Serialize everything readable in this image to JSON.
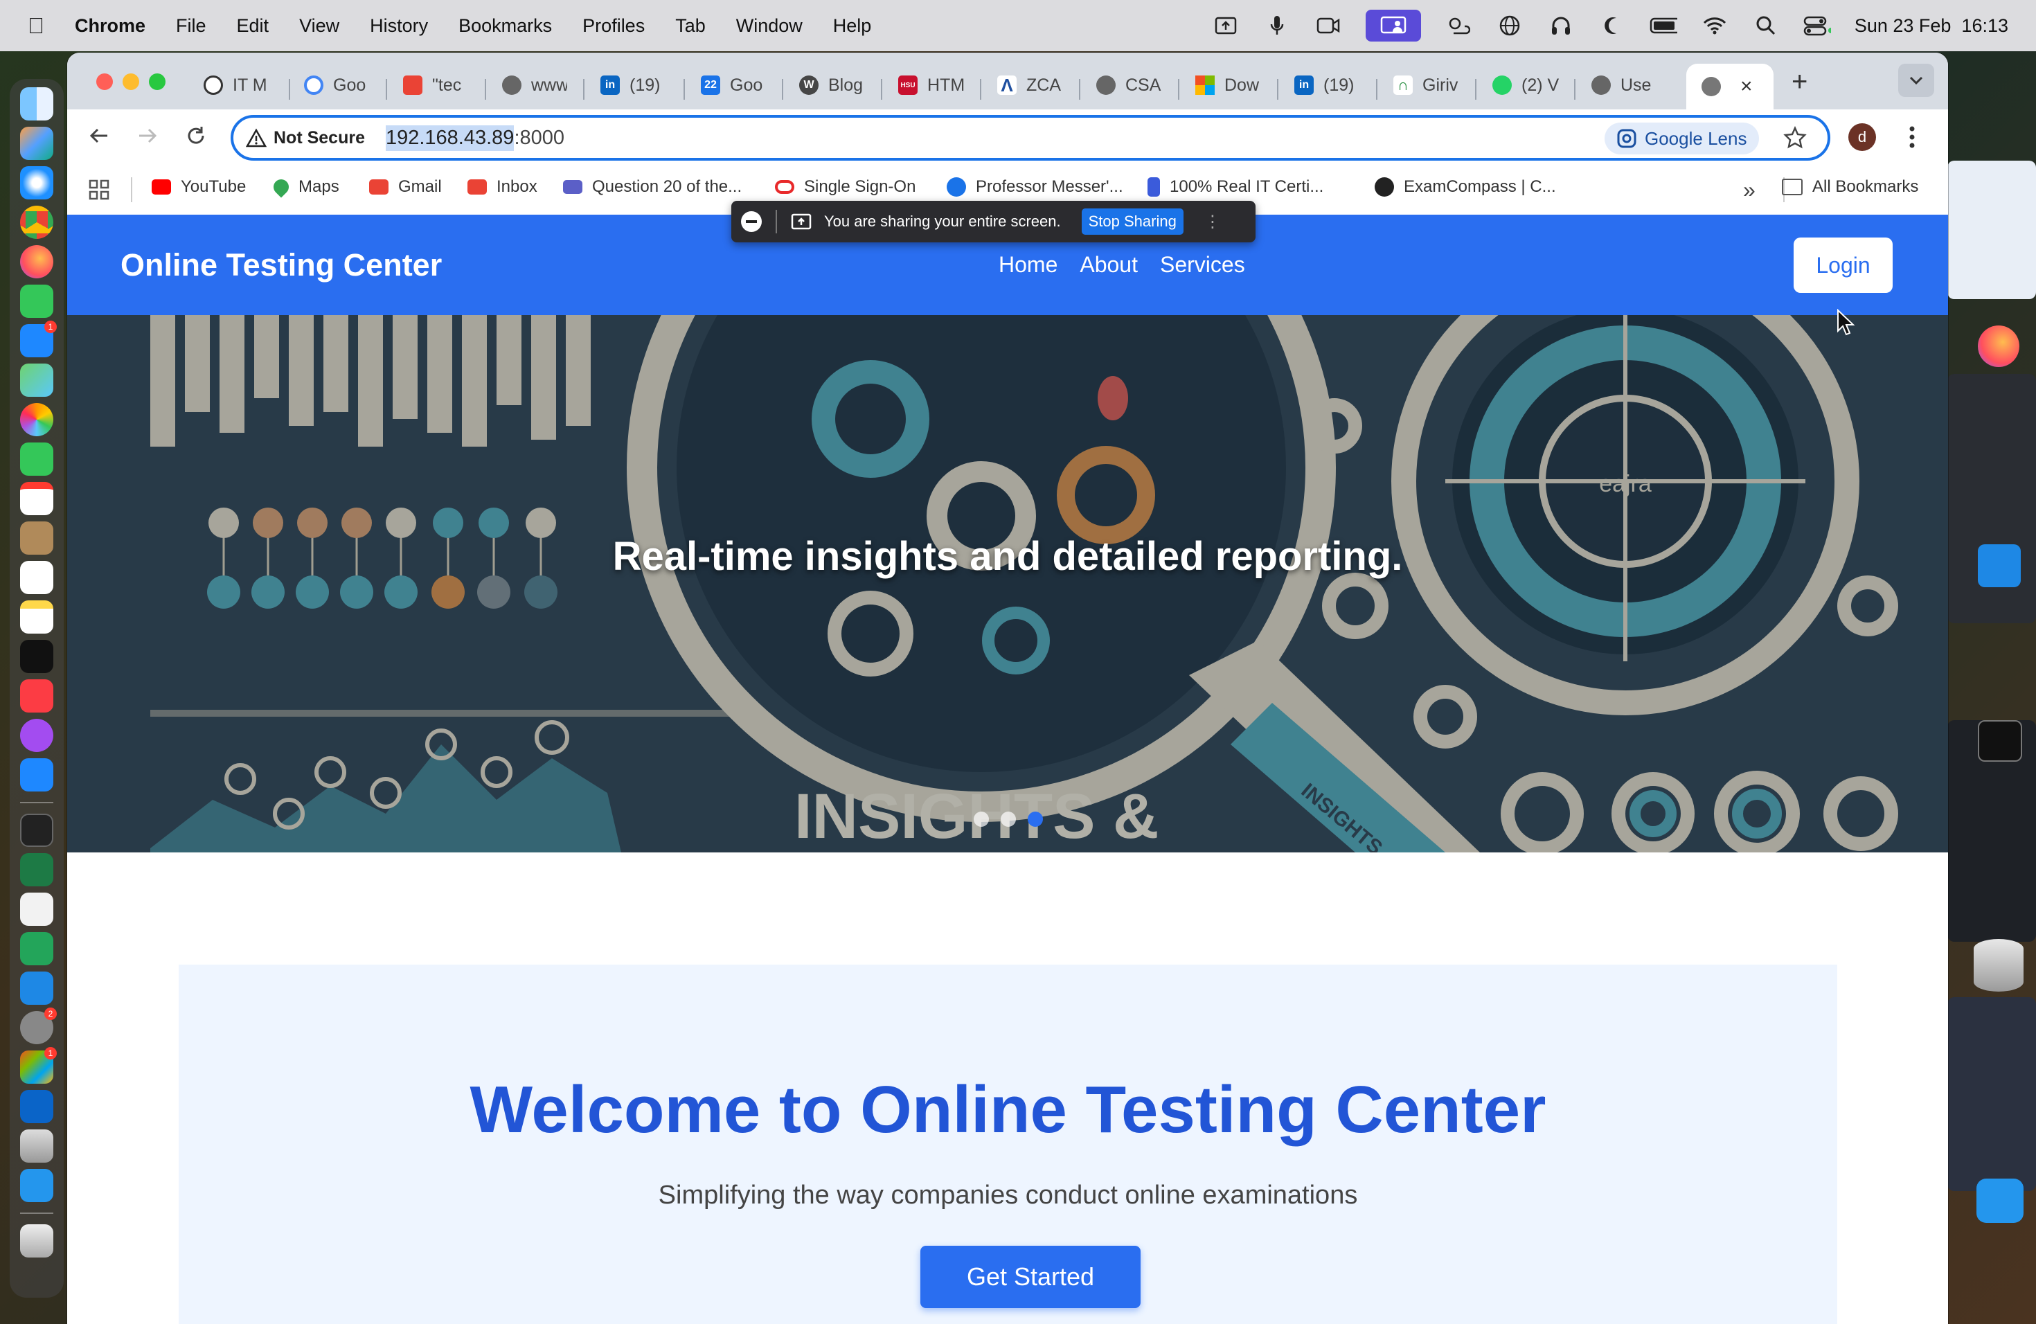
{
  "menubar": {
    "app": "Chrome",
    "items": [
      "File",
      "Edit",
      "View",
      "History",
      "Bookmarks",
      "Profiles",
      "Tab",
      "Window",
      "Help"
    ],
    "clock": "Sun 23 Feb  16:13"
  },
  "tabs": [
    {
      "label": "IT M",
      "icon": "openai-icon"
    },
    {
      "label": "Goo",
      "icon": "google-icon"
    },
    {
      "label": "\"tec",
      "icon": "gmail-icon"
    },
    {
      "label": "www",
      "icon": "globe-icon"
    },
    {
      "label": "(19)",
      "icon": "linkedin-icon"
    },
    {
      "label": "Goo",
      "icon": "google-calendar-icon"
    },
    {
      "label": "Blog",
      "icon": "wordpress-icon"
    },
    {
      "label": "HTM",
      "icon": "hsu-icon"
    },
    {
      "label": "ZCA",
      "icon": "zca-icon"
    },
    {
      "label": "CSA",
      "icon": "globe-icon"
    },
    {
      "label": "Dow",
      "icon": "microsoft-icon"
    },
    {
      "label": "(19)",
      "icon": "linkedin-icon"
    },
    {
      "label": "Giriv",
      "icon": "giri-icon"
    },
    {
      "label": "(2) V",
      "icon": "whatsapp-icon"
    },
    {
      "label": "Use",
      "icon": "globe-icon"
    }
  ],
  "address": {
    "security": "Not Secure",
    "host": "192.168.43.89",
    "port": ":8000",
    "lens": "Google Lens",
    "profile": "d"
  },
  "bookmarks": [
    {
      "label": "YouTube",
      "color": "#ff0000"
    },
    {
      "label": "Maps",
      "color": "#34a853"
    },
    {
      "label": "Gmail",
      "color": "#ea4335"
    },
    {
      "label": "Inbox",
      "color": "#ea4335"
    },
    {
      "label": "Question 20 of the...",
      "color": "#5b5fc7"
    },
    {
      "label": "Single Sign-On",
      "color": "#e8292a"
    },
    {
      "label": "Professor Messer'...",
      "color": "#1a73e8"
    },
    {
      "label": "100% Real IT Certi...",
      "color": "#3b5bdb"
    },
    {
      "label": "ExamCompass | C...",
      "color": "#222222"
    }
  ],
  "all_bookmarks": "All Bookmarks",
  "sharing": {
    "text": "You are sharing your entire screen.",
    "stop": "Stop Sharing"
  },
  "site": {
    "brand": "Online Testing Center",
    "nav": [
      "Home",
      "About",
      "Services"
    ],
    "login": "Login",
    "hero_text": "Real-time insights and detailed reporting.",
    "hero_caption": "INSIGHTS &",
    "hero_book": "INSIGHTS",
    "hero_dial": "eajra",
    "carousel": {
      "slides": 3,
      "active": 3
    },
    "welcome_title": "Welcome to Online Testing Center",
    "welcome_sub": "Simplifying the way companies conduct online examinations",
    "cta": "Get Started"
  },
  "colors": {
    "primary": "#2a6ef0",
    "title_blue": "#2255d6",
    "welcome_bg": "#eef5ff"
  }
}
